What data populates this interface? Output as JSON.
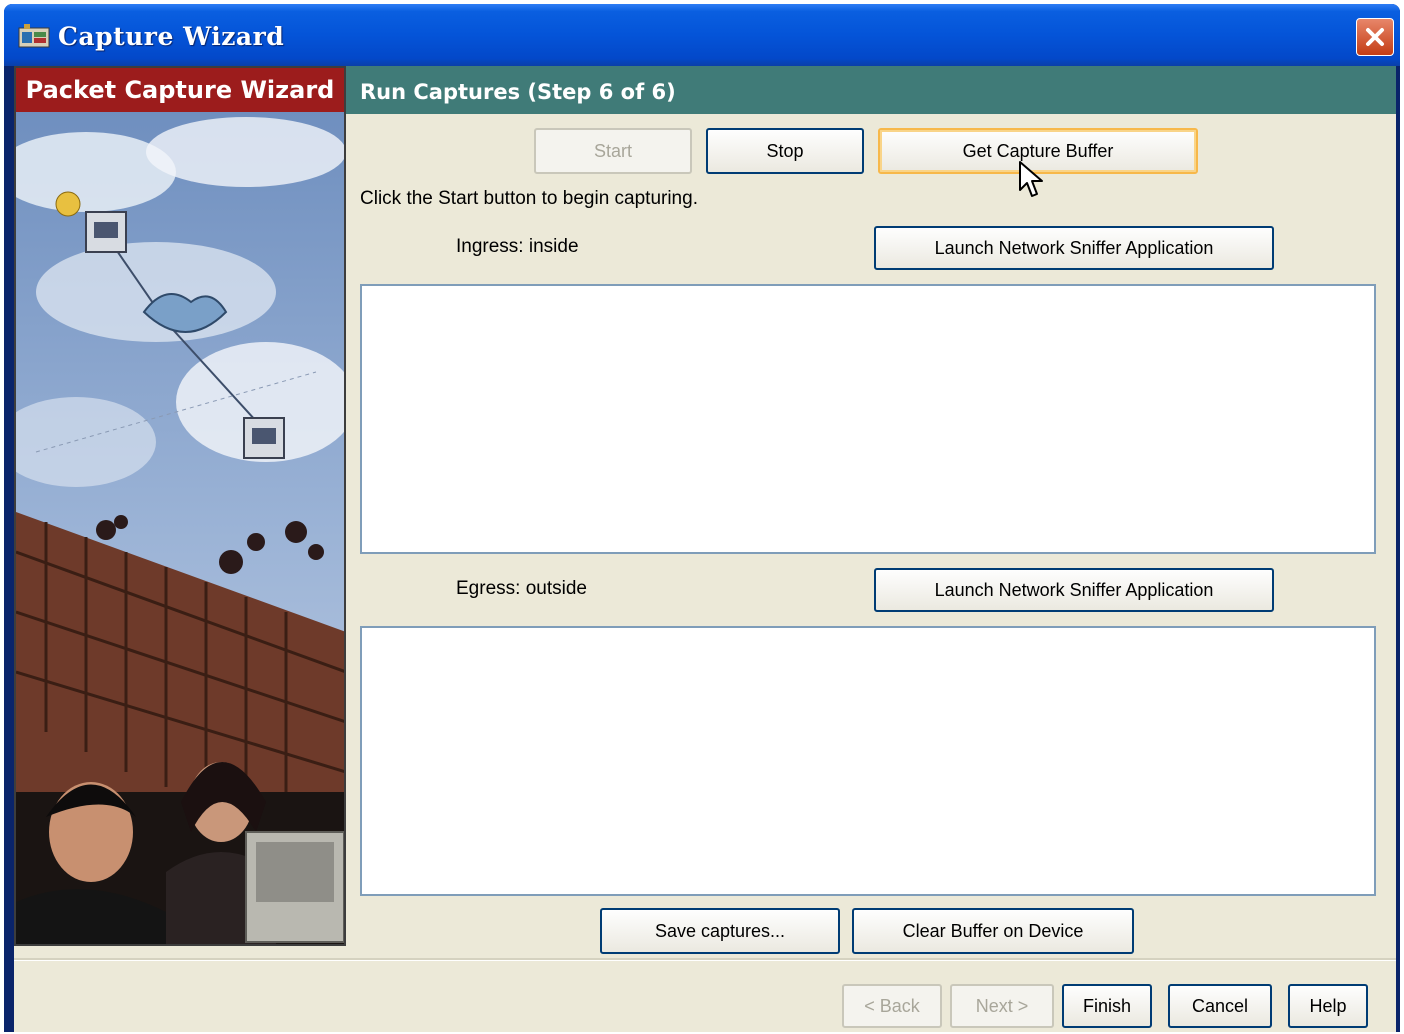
{
  "window": {
    "title": "Capture Wizard"
  },
  "side_panel": {
    "title": "Packet Capture Wizard"
  },
  "main": {
    "header": "Run Captures  (Step 6 of 6)",
    "instructions": "Click the Start button to begin capturing.",
    "buttons": {
      "start": "Start",
      "stop": "Stop",
      "get_buffer": "Get Capture Buffer",
      "launch_ingress": "Launch Network Sniffer Application",
      "launch_egress": "Launch Network Sniffer Application",
      "save": "Save captures...",
      "clear": "Clear Buffer on Device"
    },
    "ingress_label": "Ingress: inside",
    "egress_label": "Egress: outside",
    "ingress_output": "",
    "egress_output": ""
  },
  "footer": {
    "back": "< Back",
    "next": "Next >",
    "finish": "Finish",
    "cancel": "Cancel",
    "help": "Help"
  },
  "colors": {
    "title_bar": "#0454d8",
    "side_header": "#9c1c1c",
    "main_header": "#407b78",
    "dialog_bg": "#ece9d8"
  },
  "icons": {
    "app": "capture-wizard-icon",
    "close": "close-icon",
    "cursor": "mouse-pointer-icon"
  }
}
